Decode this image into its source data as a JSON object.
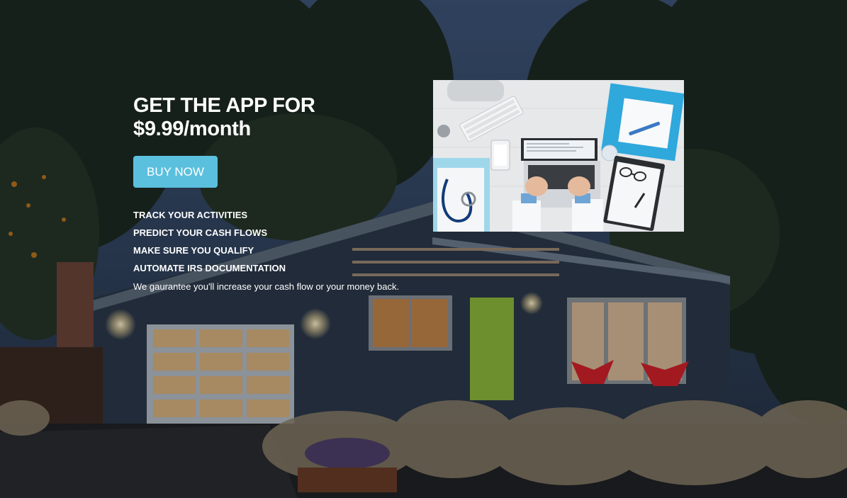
{
  "promo": {
    "headline_line1": "GET THE APP FOR",
    "headline_line2": "$9.99/month",
    "buy_button_label": "BUY NOW",
    "features": [
      "TRACK YOUR ACTIVITIES",
      "PREDICT YOUR CASH FLOWS",
      "MAKE SURE YOU QUALIFY",
      "AUTOMATE IRS DOCUMENTATION"
    ],
    "guarantee_text": "We gaurantee you'll increase your cash flow or your money back."
  },
  "colors": {
    "accent": "#5bc0de",
    "door": "#8cb83a",
    "chairs": "#d0202a"
  },
  "icons": {
    "stethoscope": "stethoscope-icon",
    "thermometer": "thermometer-icon",
    "glasses": "glasses-icon"
  }
}
